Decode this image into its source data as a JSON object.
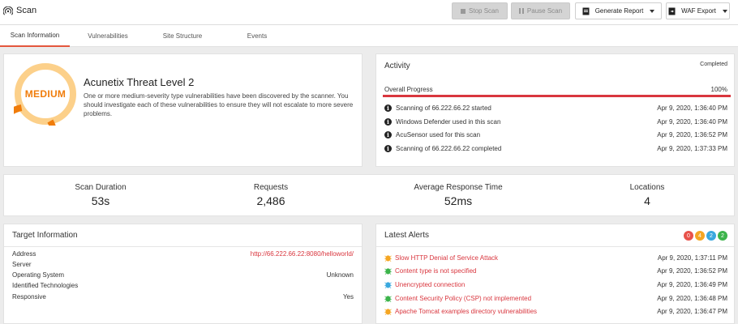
{
  "header": {
    "title": "Scan",
    "buttons": {
      "stop_scan": "Stop Scan",
      "pause_scan": "Pause Scan",
      "generate_report": "Generate Report",
      "waf_export": "WAF Export"
    }
  },
  "tabs": [
    {
      "label": "Scan Information",
      "active": true
    },
    {
      "label": "Vulnerabilities",
      "active": false
    },
    {
      "label": "Site Structure",
      "active": false
    },
    {
      "label": "Events",
      "active": false
    }
  ],
  "threat": {
    "level_label": "MEDIUM",
    "title": "Acunetix Threat Level 2",
    "description": "One or more medium-severity type vulnerabilities have been discovered by the scanner. You should investigate each of these vulnerabilities to ensure they will not escalate to more severe problems.",
    "colors": {
      "outer": "#f07c0a",
      "inner": "#fcd08a"
    }
  },
  "activity": {
    "title": "Activity",
    "status": "Completed",
    "progress_label": "Overall Progress",
    "progress_text": "100%",
    "progress_fraction": 1.0,
    "events": [
      {
        "text": "Scanning of 66.222.66.22 started",
        "time": "Apr 9, 2020, 1:36:40 PM"
      },
      {
        "text": "Windows Defender used in this scan",
        "time": "Apr 9, 2020, 1:36:40 PM"
      },
      {
        "text": "AcuSensor used for this scan",
        "time": "Apr 9, 2020, 1:36:52 PM"
      },
      {
        "text": "Scanning of 66.222.66.22 completed",
        "time": "Apr 9, 2020, 1:37:33 PM"
      }
    ]
  },
  "stats": [
    {
      "label": "Scan Duration",
      "value": "53s"
    },
    {
      "label": "Requests",
      "value": "2,486"
    },
    {
      "label": "Average Response Time",
      "value": "52ms"
    },
    {
      "label": "Locations",
      "value": "4"
    }
  ],
  "target": {
    "title": "Target Information",
    "rows": [
      {
        "label": "Address",
        "value": "http://66.222.66.22:8080/helloworld/"
      },
      {
        "label": "Server",
        "value": ""
      },
      {
        "label": "Operating System",
        "value": "Unknown"
      },
      {
        "label": "Identified Technologies",
        "value": ""
      },
      {
        "label": "Responsive",
        "value": "Yes"
      }
    ]
  },
  "alerts": {
    "title": "Latest Alerts",
    "badges": [
      {
        "count": "0",
        "color": "#e8524a"
      },
      {
        "count": "4",
        "color": "#f5a623"
      },
      {
        "count": "2",
        "color": "#3aa8de"
      },
      {
        "count": "2",
        "color": "#3cb44b"
      }
    ],
    "items": [
      {
        "name": "Slow HTTP Denial of Service Attack",
        "time": "Apr 9, 2020, 1:37:11 PM",
        "icon": "bug-icon",
        "color": "#f5a623"
      },
      {
        "name": "Content type is not specified",
        "time": "Apr 9, 2020, 1:36:52 PM",
        "icon": "bug-icon",
        "color": "#3cb44b"
      },
      {
        "name": "Unencrypted connection",
        "time": "Apr 9, 2020, 1:36:49 PM",
        "icon": "bug-icon",
        "color": "#3aa8de"
      },
      {
        "name": "Content Security Policy (CSP) not implemented",
        "time": "Apr 9, 2020, 1:36:48 PM",
        "icon": "bug-icon",
        "color": "#3cb44b"
      },
      {
        "name": "Apache Tomcat examples directory vulnerabilities",
        "time": "Apr 9, 2020, 1:36:47 PM",
        "icon": "bug-icon",
        "color": "#f5a623"
      }
    ]
  }
}
